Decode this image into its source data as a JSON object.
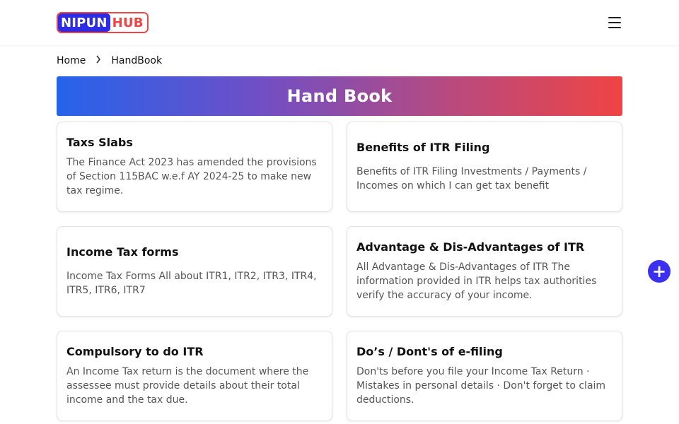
{
  "header": {
    "logo_part1": "NIPUN",
    "logo_part2": "HUB",
    "menu_icon": "hamburger-menu-icon"
  },
  "breadcrumb": {
    "home": "Home",
    "separator_icon": "chevron-right-icon",
    "current": "HandBook"
  },
  "banner": {
    "title": "Hand Book"
  },
  "cards": [
    {
      "title": "Taxs Slabs",
      "description": "The Finance Act 2023 has amended the provisions of Section 115BAC w.e.f AY 2024-25 to make new tax regime."
    },
    {
      "title": "Benefits of ITR Filing",
      "description": "Benefits of ITR Filing Investments / Payments / Incomes on which I can get tax benefit"
    },
    {
      "title": "Income Tax forms",
      "description": "Income Tax Forms All about ITR1, ITR2, ITR3, ITR4, ITR5, ITR6, ITR7"
    },
    {
      "title": "Advantage & Dis-Advantages of ITR",
      "description": "All Advantage & Dis-Advantages of ITR The information provided in ITR helps tax authorities verify the accuracy of your income."
    },
    {
      "title": "Compulsory to do ITR",
      "description": "An Income Tax return is the document where the assessee must provide details about their total income and the tax due."
    },
    {
      "title": "Do’s / Dont's of e-filing",
      "description": "Don'ts before you file your Income Tax Return · Mistakes in personal details · Don't forget to claim deductions."
    }
  ],
  "fab": {
    "icon": "plus-icon",
    "symbol": "+"
  },
  "colors": {
    "brand_blue": "#2b2be8",
    "brand_red": "#ef4444",
    "gradient_start": "#2563eb",
    "gradient_end": "#ef4444",
    "fab": "#3b2ff0"
  }
}
